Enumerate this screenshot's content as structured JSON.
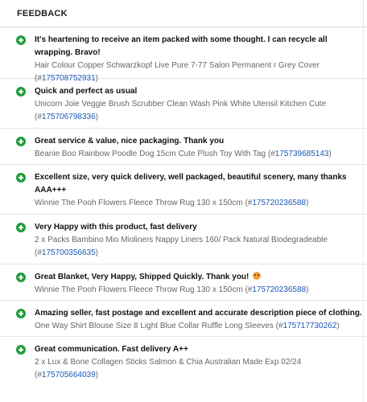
{
  "header": {
    "title": "FEEDBACK"
  },
  "feedback": [
    {
      "comment": "It's heartening to receive an item packed with some thought. I can recycle all wrapping. Bravo!",
      "item": "Hair Colour Copper Schwarzkopf Live Pure 7-77 Salon Permanent r Grey Cover",
      "id_prefix": "(#",
      "item_id": "175708752931",
      "id_suffix": ")"
    },
    {
      "comment": "Quick and perfect as usual",
      "item": "Unicorn Joie Veggie Brush Scrubber Clean Wash Pink White Utensil Kitchen Cute",
      "id_prefix": "(#",
      "item_id": "175706798336",
      "id_suffix": ")"
    },
    {
      "comment": "Great service & value, nice packaging. Thank you",
      "item": "Beanie Boo Rainbow Poodle Dog 15cm Cute Plush Toy With Tag",
      "id_prefix": "(#",
      "item_id": "175739685143",
      "id_suffix": ")"
    },
    {
      "comment": "Excellent size, very quick delivery, well packaged, beautiful scenery, many thanks AAA+++",
      "item": "Winnie The Pooh Flowers Fleece Throw Rug 130 x 150cm",
      "id_prefix": "(#",
      "item_id": "175720236588",
      "id_suffix": ")"
    },
    {
      "comment": "Very Happy with this product, fast delivery",
      "item": "2 x Packs Bambino Mio Mioliners Nappy Liners 160/ Pack Natural Biodegradeable",
      "id_prefix": "(#",
      "item_id": "175700356635",
      "id_suffix": ")"
    },
    {
      "comment": "Great Blanket, Very Happy, Shipped Quickly. Thank you!",
      "item": "Winnie The Pooh Flowers Fleece Throw Rug 130 x 150cm",
      "id_prefix": "(#",
      "item_id": "175720236588",
      "id_suffix": ")"
    },
    {
      "comment": "Amazing seller, fast postage and excellent and accurate description piece of clothing.",
      "item": "One Way Shirt Blouse Size 8 Light Blue Collar Ruffle Long Sleeves",
      "id_prefix": "(#",
      "item_id": "175717730262",
      "id_suffix": ")"
    },
    {
      "comment": "Great communication. Fast delivery A++",
      "item": "2 x Lux & Bone Collagen Sticks Salmon & Chia Australian Made Exp 02/24",
      "id_prefix": "(#",
      "item_id": "175705664039",
      "id_suffix": ")"
    }
  ],
  "icons": {
    "positive": "plus-circle-icon",
    "emoji": "smiley-icon"
  },
  "colors": {
    "positive": "#1f9d3a",
    "link": "#1a58b6",
    "muted": "#666666"
  }
}
